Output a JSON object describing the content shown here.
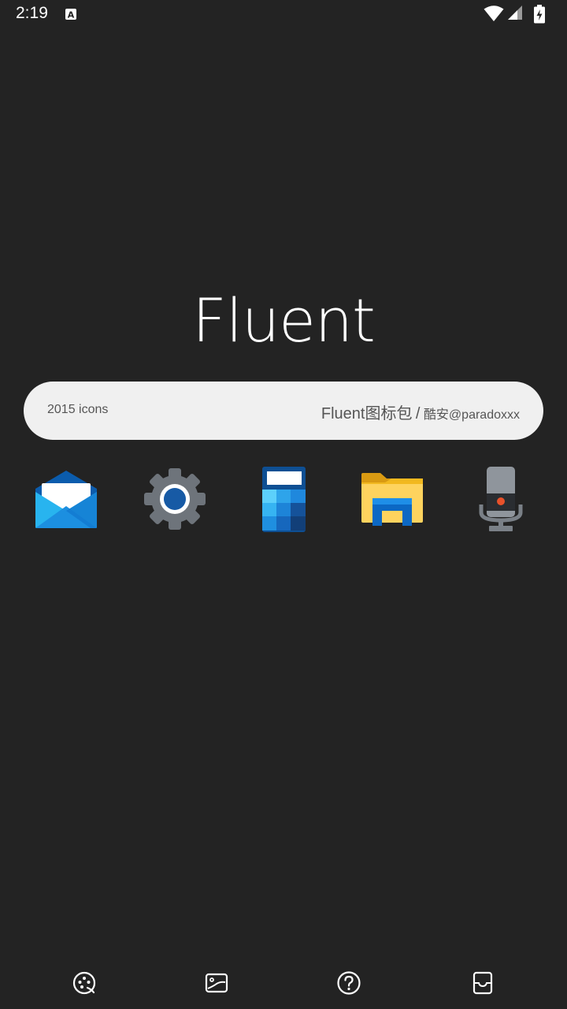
{
  "status_bar": {
    "time": "2:19",
    "notification_icon": "keyboard-a-icon",
    "icons": [
      "wifi-icon",
      "signal-icon",
      "battery-charging-icon"
    ]
  },
  "logo": {
    "text": "Fluent"
  },
  "info_pill": {
    "icon_count": "2015 icons",
    "title": "Fluent图标包",
    "separator": "/",
    "author": "酷安@paradoxxx"
  },
  "preview_icons": [
    {
      "name": "mail-icon"
    },
    {
      "name": "settings-gear-icon"
    },
    {
      "name": "calculator-icon"
    },
    {
      "name": "file-explorer-icon"
    },
    {
      "name": "voice-recorder-icon"
    }
  ],
  "bottom_nav": [
    {
      "name": "icon-pack-icon"
    },
    {
      "name": "wallpaper-icon"
    },
    {
      "name": "help-icon"
    },
    {
      "name": "about-icon"
    }
  ],
  "colors": {
    "background": "#232323",
    "pill": "#f0f0f0",
    "pill_text": "#555555"
  }
}
